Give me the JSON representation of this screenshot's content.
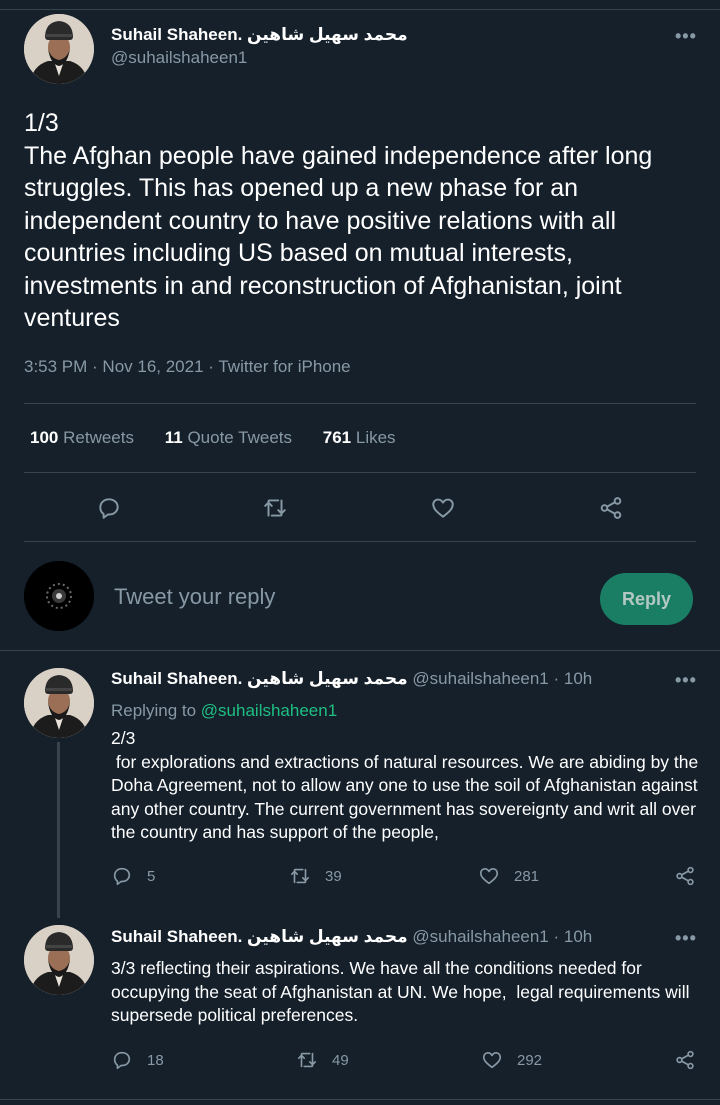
{
  "main_tweet": {
    "author_name": "Suhail Shaheen. محمد سهيل شاهين",
    "author_handle": "@suhailshaheen1",
    "text": "1/3\nThe Afghan people have gained independence after long struggles. This has opened up a new phase for an independent country to have positive relations with all countries including US based on mutual interests, investments in and reconstruction of Afghanistan, joint ventures",
    "time": "3:53 PM · Nov 16, 2021",
    "source": "Twitter for iPhone",
    "stats": {
      "retweets_count": "100",
      "retweets_label": "Retweets",
      "quotes_count": "11",
      "quotes_label": "Quote Tweets",
      "likes_count": "761",
      "likes_label": "Likes"
    }
  },
  "reply_box": {
    "placeholder": "Tweet your reply",
    "button_label": "Reply"
  },
  "thread": [
    {
      "author_name": "Suhail Shaheen. محمد سهيل شاهين",
      "author_handle": "@suhailshaheen1",
      "time": "· 10h",
      "replying_prefix": "Replying to",
      "replying_to": "@suhailshaheen1",
      "text": "2/3\n for explorations and extractions of natural resources. We are abiding by the Doha Agreement, not to allow any one to use the soil of Afghanistan against any other country. The current government has sovereignty and writ all over the country and has support of the people,",
      "replies": "5",
      "retweets": "39",
      "likes": "281"
    },
    {
      "author_name": "Suhail Shaheen. محمد سهيل شاهين",
      "author_handle": "@suhailshaheen1",
      "time": "· 10h",
      "text": "3/3 reflecting their aspirations. We have all the conditions needed for occupying the seat of Afghanistan at UN. We hope,  legal requirements will supersede political preferences.",
      "replies": "18",
      "retweets": "49",
      "likes": "292"
    }
  ],
  "icons": {
    "more": "•••",
    "reply": "reply-icon",
    "retweet": "retweet-icon",
    "like": "heart-icon",
    "share": "share-icon"
  },
  "colors": {
    "background": "#15202b",
    "secondary_text": "#8899a6",
    "accent": "#1fbf82",
    "reply_button": "#1a8f6e",
    "divider": "#38444d"
  }
}
